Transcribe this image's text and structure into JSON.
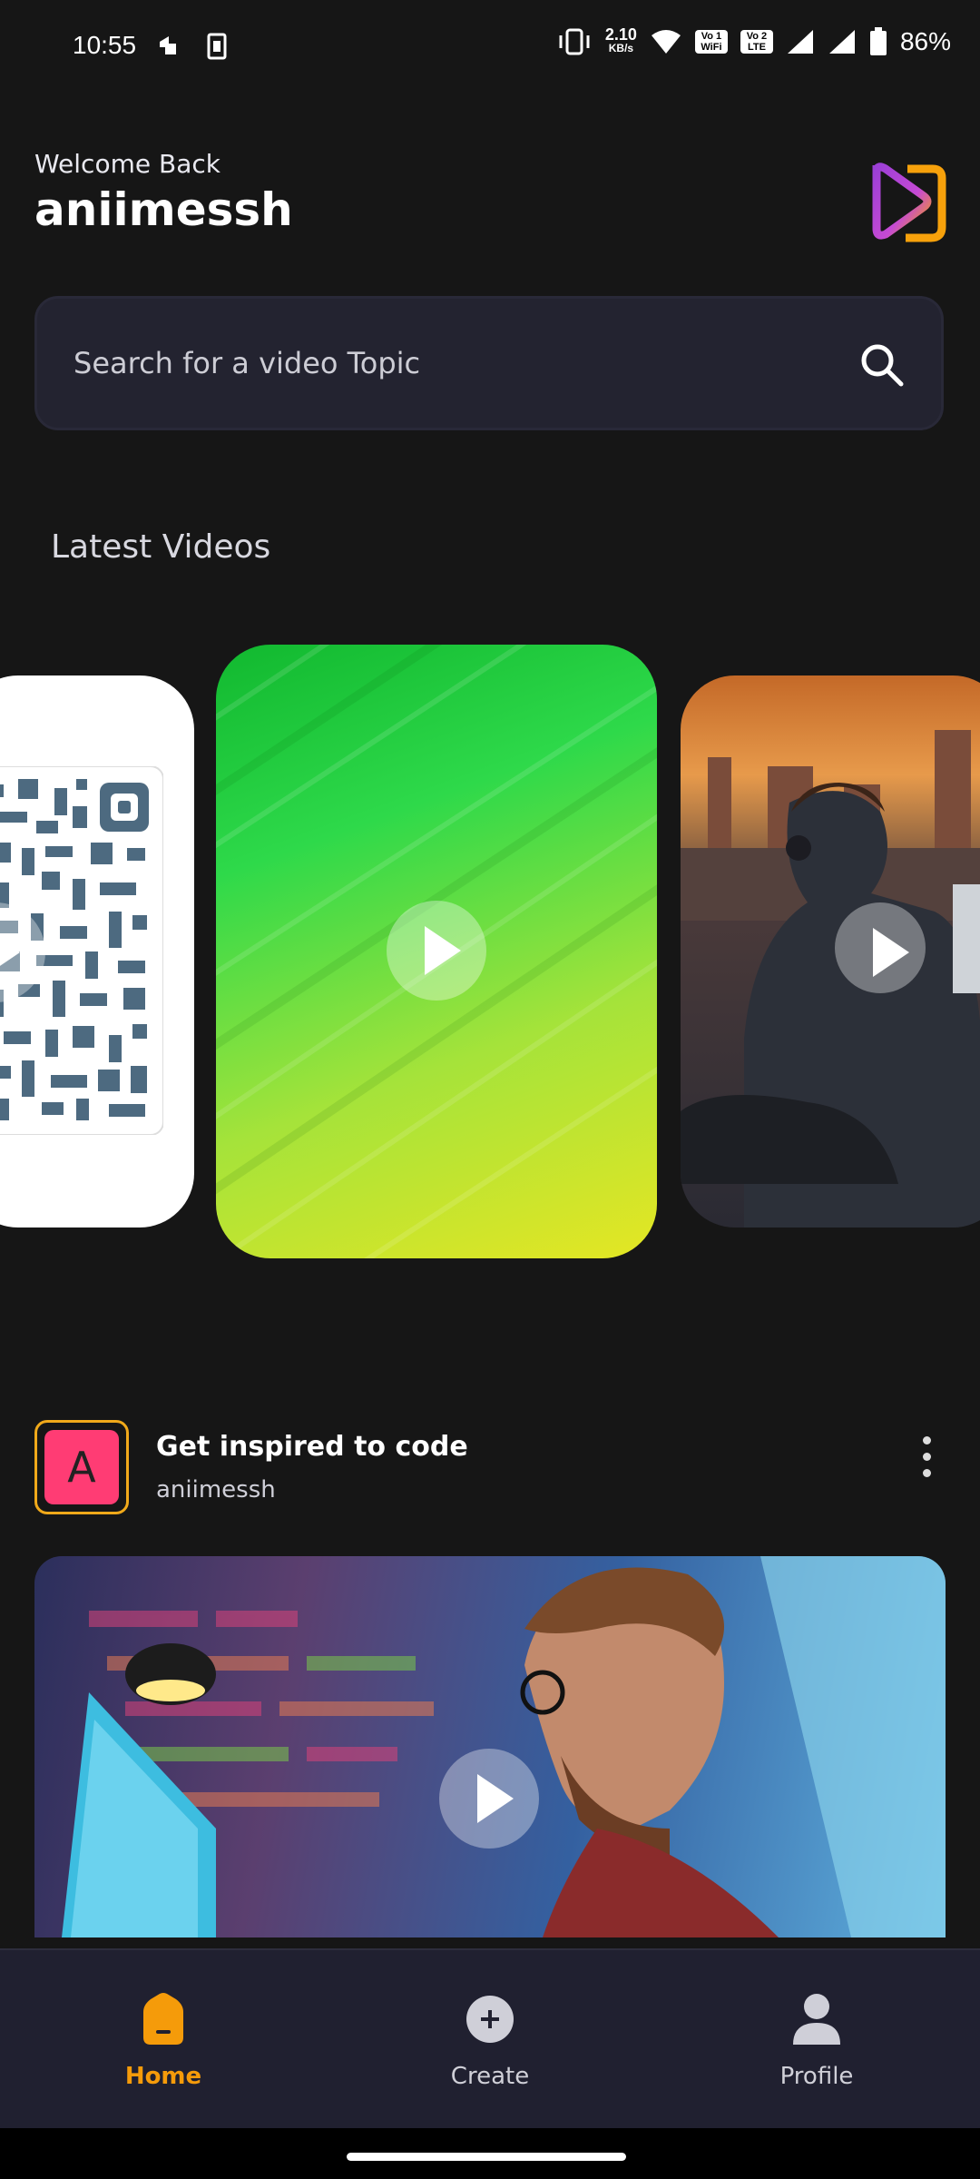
{
  "status_bar": {
    "time": "10:55",
    "net_speed_value": "2.10",
    "net_speed_unit": "KB/s",
    "sim1": "Vo 1 WiFi",
    "sim2": "Vo 2 LTE",
    "battery": "86%"
  },
  "header": {
    "welcome": "Welcome Back",
    "username": "aniimessh",
    "logo_icon": "app-logo-icon"
  },
  "search": {
    "placeholder": "Search for a video Topic",
    "icon": "search-icon"
  },
  "latest": {
    "title": "Latest Videos",
    "cards": [
      {
        "thumbnail": "qr-code"
      },
      {
        "thumbnail": "green-yellow-gradient"
      },
      {
        "thumbnail": "person-with-headphones-city"
      }
    ]
  },
  "post": {
    "avatar_letter": "A",
    "title": "Get inspired to code",
    "author": "aniimessh"
  },
  "nav": {
    "home": "Home",
    "create": "Create",
    "profile": "Profile"
  },
  "colors": {
    "accent": "#f59b0a",
    "avatar_bg": "#ff3c74",
    "background": "#161616",
    "surface": "#232330"
  }
}
